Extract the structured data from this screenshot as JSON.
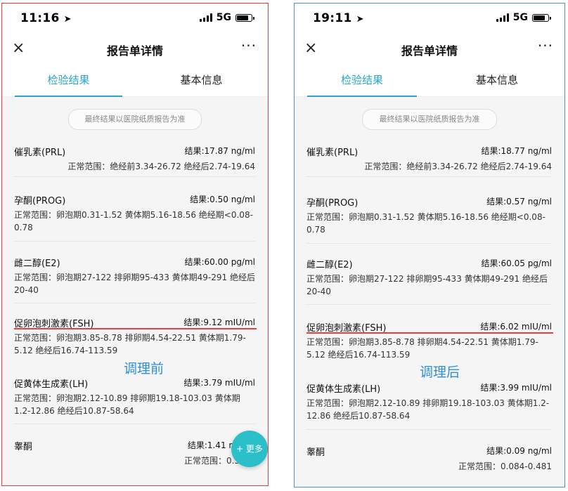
{
  "left": {
    "status": {
      "time": "11:16",
      "network": "5G"
    },
    "nav": {
      "close": "×",
      "title": "报告单详情",
      "more": "···"
    },
    "tabs": [
      {
        "label": "检验结果"
      },
      {
        "label": "基本信息"
      }
    ],
    "notice": "最终结果以医院纸质报告为准",
    "items": [
      {
        "name": "催乳素(PRL)",
        "result": "结果:17.87 ng/ml",
        "range": "正常范围：绝经前3.34-26.72 绝经后2.74-19.64"
      },
      {
        "name": "孕酮(PROG)",
        "result": "结果:0.50 ng/ml",
        "range": "正常范围：卵泡期0.31-1.52 黄体期5.16-18.56 绝经期<0.08-0.78"
      },
      {
        "name": "雌二醇(E2)",
        "result": "结果:60.00 pg/ml",
        "range": "正常范围：卵泡期27-122 排卵期95-433 黄体期49-291 绝经后20-40"
      },
      {
        "name": "促卵泡刺激素(FSH)",
        "result": "结果:9.12 mIU/ml",
        "range": "正常范围：卵泡期3.85-8.78 排卵期4.54-22.51 黄体期1.79-5.12 绝经后16.74-113.59"
      },
      {
        "name": "促黄体生成素(LH)",
        "result": "结果:3.79 mIU/ml",
        "range": "正常范围：卵泡期2.12-10.89 排卵期19.18-103.03 黄体期1.2-12.86 绝经后10.87-58.64"
      },
      {
        "name": "睾酮",
        "result": "结果:1.41 n",
        "range": "正常范围：0.35-"
      }
    ],
    "label": "调理前",
    "fab": "+ 更多"
  },
  "right": {
    "status": {
      "time": "19:11",
      "network": "5G"
    },
    "nav": {
      "close": "×",
      "title": "报告单详情",
      "more": "···"
    },
    "tabs": [
      {
        "label": "检验结果"
      },
      {
        "label": "基本信息"
      }
    ],
    "notice": "最终结果以医院纸质报告为准",
    "items": [
      {
        "name": "催乳素(PRL)",
        "result": "结果:18.77 ng/ml",
        "range": "正常范围：绝经前3.34-26.72 绝经后2.74-19.64"
      },
      {
        "name": "孕酮(PROG)",
        "result": "结果:0.57 ng/ml",
        "range": "正常范围：卵泡期0.31-1.52 黄体期5.16-18.56 绝经期<0.08-0.78"
      },
      {
        "name": "雌二醇(E2)",
        "result": "结果:60.05 pg/ml",
        "range": "正常范围：卵泡期27-122 排卵期95-433 黄体期49-291 绝经后20-40"
      },
      {
        "name": "促卵泡刺激素(FSH)",
        "result": "结果:6.02 mIU/ml",
        "range": "正常范围：卵泡期3.85-8.78 排卵期4.54-22.51 黄体期1.79-5.12 绝经后16.74-113.59"
      },
      {
        "name": "促黄体生成素(LH)",
        "result": "结果:3.99 mIU/ml",
        "range": "正常范围：卵泡期2.12-10.89 排卵期19.18-103.03 黄体期1.2-12.86 绝经后10.87-58.64"
      },
      {
        "name": "睾酮",
        "result": "结果:0.09 ng/ml",
        "range": "正常范围：0.084-0.481"
      }
    ],
    "label": "调理后"
  },
  "colors": {
    "accent": "#2ba6c7",
    "before_border": "#e8403f",
    "after_border": "#4d8ed6",
    "label": "#2f8fd6",
    "fab": "#2bbfc9"
  }
}
